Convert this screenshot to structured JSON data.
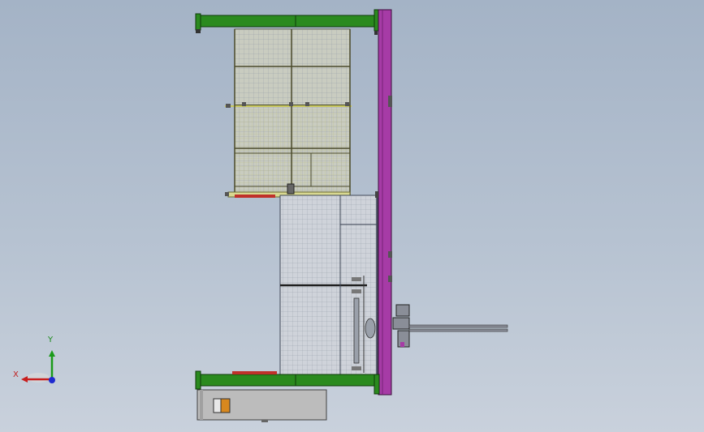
{
  "viewport": {
    "background_top": "#a4b3c6",
    "background_bottom": "#c9d1dc"
  },
  "colors": {
    "frame_green": "#2a8a1e",
    "column_purple": "#a63ba6",
    "panel_yellow": "#d8d890",
    "mesh_gray": "#c8ccd4",
    "cabinet_gray": "#bcbcbc",
    "red_strip": "#c0302a",
    "orange_label": "#d8881e"
  },
  "triad": {
    "y_label": "Y",
    "x_label": "X",
    "y_color": "#1a9a1a",
    "x_color": "#c81e1e",
    "z_color": "#1e2ad0"
  },
  "model": {
    "description_icon": "cad-assembly-side-view-icon"
  }
}
